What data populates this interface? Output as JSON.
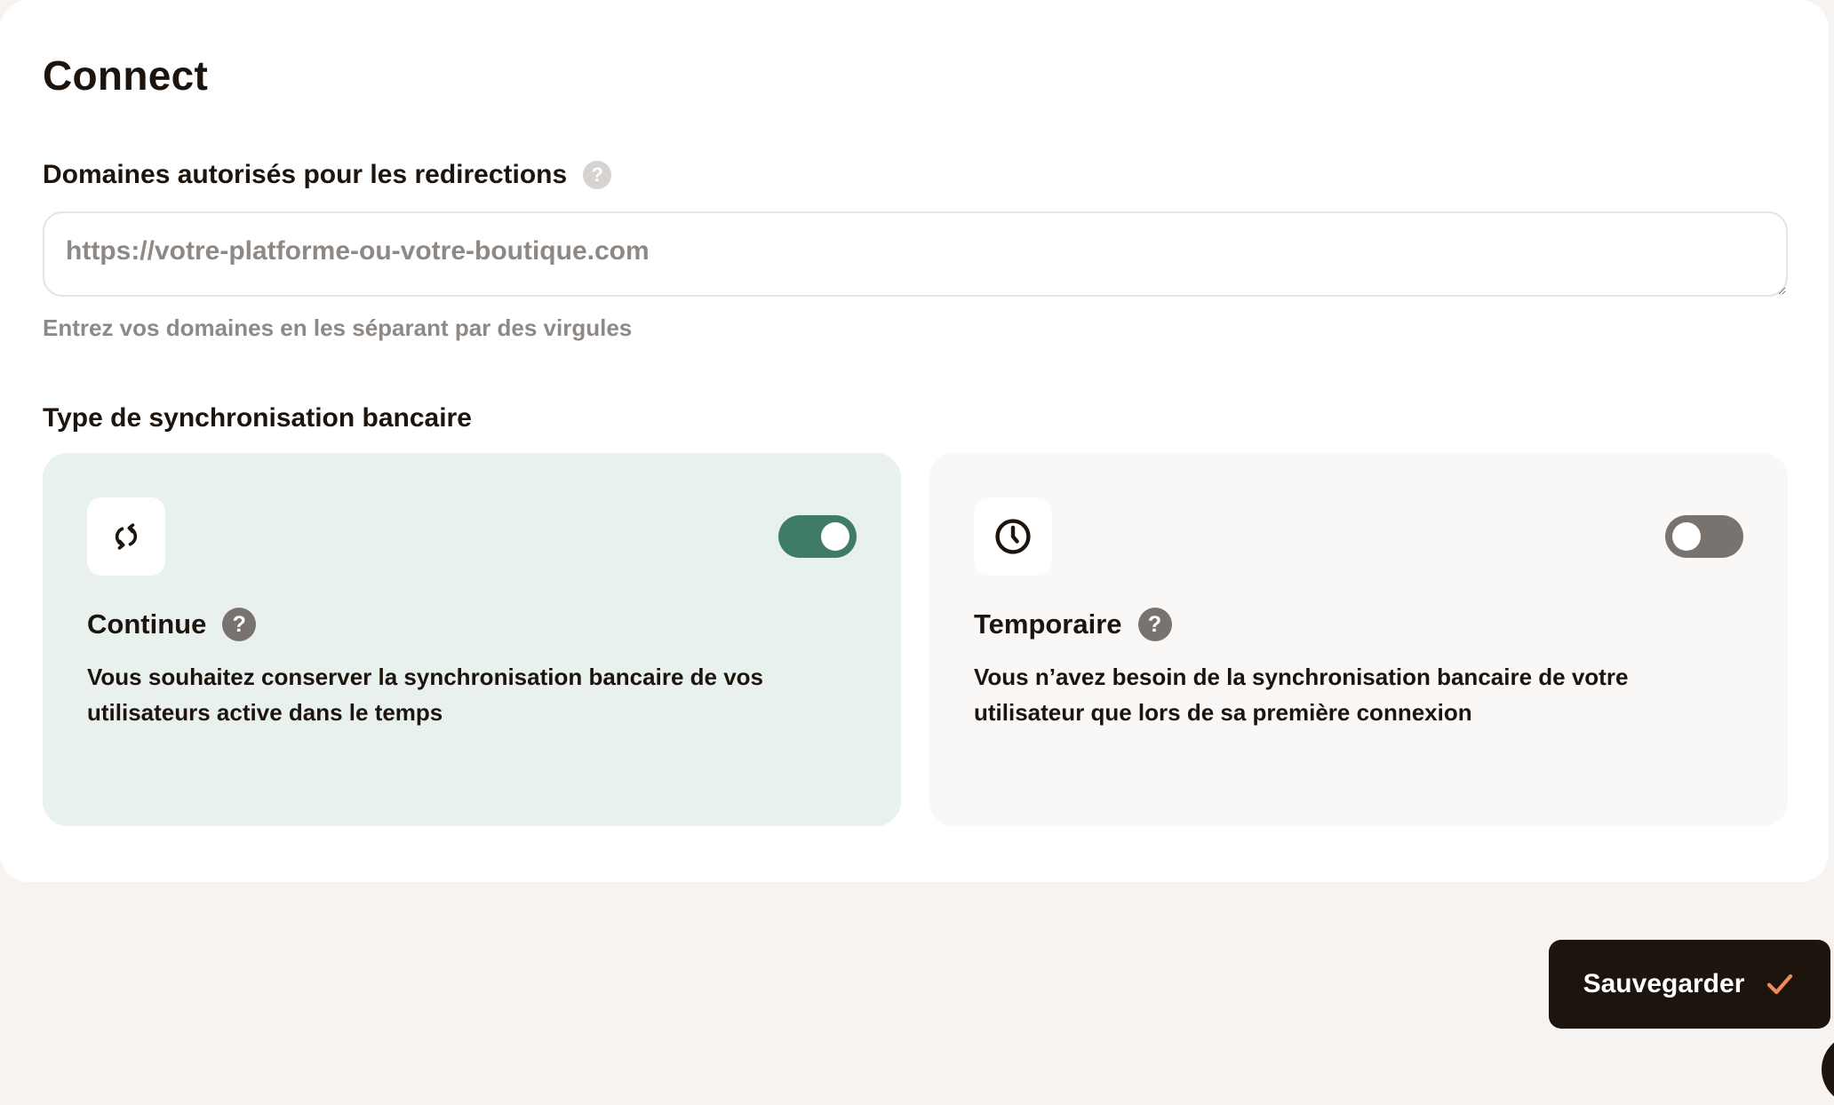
{
  "page": {
    "title": "Connect"
  },
  "redirect_domains": {
    "label": "Domaines autorisés pour les redirections",
    "help": "?",
    "value": "",
    "placeholder": "https://votre-platforme-ou-votre-boutique.com",
    "hint": "Entrez vos domaines en les séparant par des virgules"
  },
  "bank_sync": {
    "label": "Type de synchronisation bancaire",
    "options": [
      {
        "title": "Continue",
        "help": "?",
        "description": "Vous souhaitez conserver la synchronisation bancaire de vos utilisateurs active dans le temps",
        "enabled": true,
        "icon": "sync-icon"
      },
      {
        "title": "Temporaire",
        "help": "?",
        "description": "Vous n’avez besoin de la synchronisation bancaire de votre utilisateur que lors de sa première connexion",
        "enabled": false,
        "icon": "clock-icon"
      }
    ]
  },
  "actions": {
    "save_label": "Sauvegarder",
    "save_icon": "check-icon"
  },
  "colors": {
    "page_background": "#f6f3f0",
    "card_background": "#ffffff",
    "text_primary": "#1c140d",
    "text_muted": "#8f8985",
    "selected_option_background": "#e8f1ee",
    "unselected_option_background": "#f9f8f6",
    "toggle_on": "#3e7c66",
    "toggle_off": "#79736f",
    "accent_check": "#f08a5d"
  }
}
